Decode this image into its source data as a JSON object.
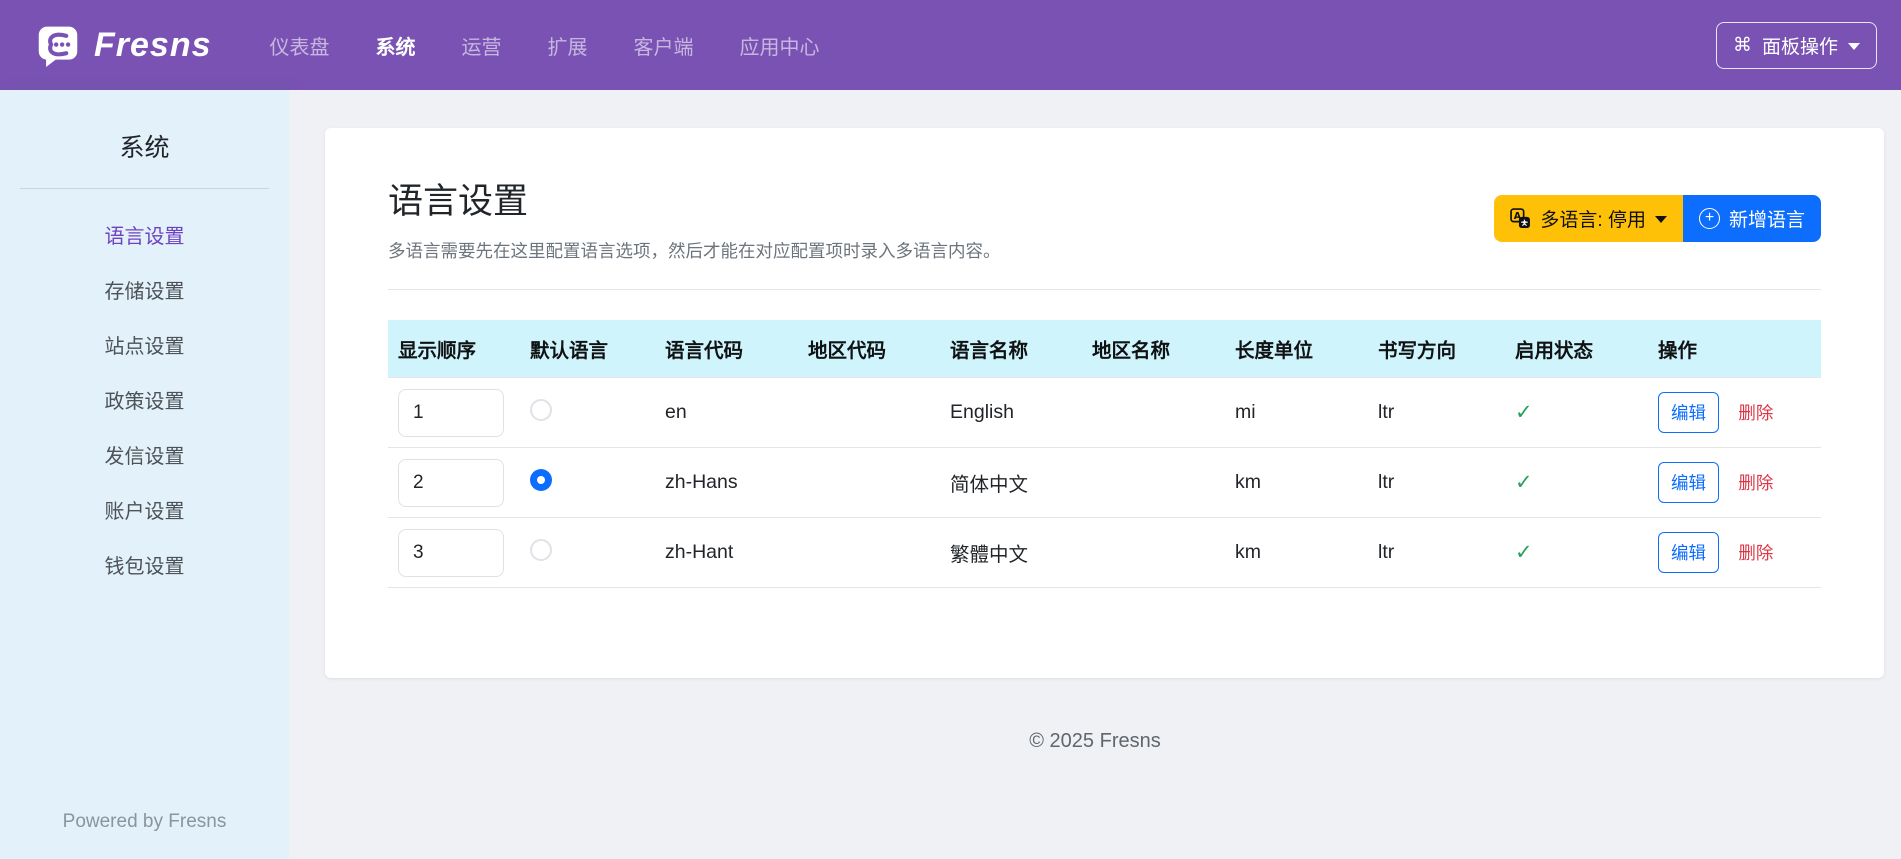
{
  "navbar": {
    "brand": "Fresns",
    "items": [
      {
        "label": "仪表盘",
        "active": false
      },
      {
        "label": "系统",
        "active": true
      },
      {
        "label": "运营",
        "active": false
      },
      {
        "label": "扩展",
        "active": false
      },
      {
        "label": "客户端",
        "active": false
      },
      {
        "label": "应用中心",
        "active": false
      }
    ],
    "panel_button": {
      "icon": "⌘",
      "label": "面板操作"
    }
  },
  "sidebar": {
    "title": "系统",
    "items": [
      {
        "label": "语言设置",
        "active": true
      },
      {
        "label": "存储设置",
        "active": false
      },
      {
        "label": "站点设置",
        "active": false
      },
      {
        "label": "政策设置",
        "active": false
      },
      {
        "label": "发信设置",
        "active": false
      },
      {
        "label": "账户设置",
        "active": false
      },
      {
        "label": "钱包设置",
        "active": false
      }
    ],
    "footer": "Powered by Fresns"
  },
  "main": {
    "title": "语言设置",
    "subtitle": "多语言需要先在这里配置语言选项，然后才能在对应配置项时录入多语言内容。",
    "multilang_button": "多语言: 停用",
    "add_button": "新增语言",
    "table": {
      "headers": [
        "显示顺序",
        "默认语言",
        "语言代码",
        "地区代码",
        "语言名称",
        "地区名称",
        "长度单位",
        "书写方向",
        "启用状态",
        "操作"
      ],
      "check_glyph": "✓",
      "edit_label": "编辑",
      "delete_label": "删除",
      "rows": [
        {
          "order": "1",
          "is_default": false,
          "lang_code": "en",
          "area_code": "",
          "lang_name": "English",
          "area_name": "",
          "length_unit": "mi",
          "direction": "ltr",
          "enabled": true
        },
        {
          "order": "2",
          "is_default": true,
          "lang_code": "zh-Hans",
          "area_code": "",
          "lang_name": "简体中文",
          "area_name": "",
          "length_unit": "km",
          "direction": "ltr",
          "enabled": true
        },
        {
          "order": "3",
          "is_default": false,
          "lang_code": "zh-Hant",
          "area_code": "",
          "lang_name": "繁體中文",
          "area_name": "",
          "length_unit": "km",
          "direction": "ltr",
          "enabled": true
        }
      ]
    },
    "copyright": "© 2025 Fresns"
  },
  "colors": {
    "navbar": "#7952b3",
    "sidebar_bg": "#e3f1fb",
    "sidebar_active": "#6f42c1",
    "table_header_bg": "#cff4fc",
    "primary": "#0d6efd",
    "warning": "#ffc107",
    "danger": "#dc3545",
    "success_check": "#2aa05a",
    "page_bg": "#eff1f4"
  }
}
